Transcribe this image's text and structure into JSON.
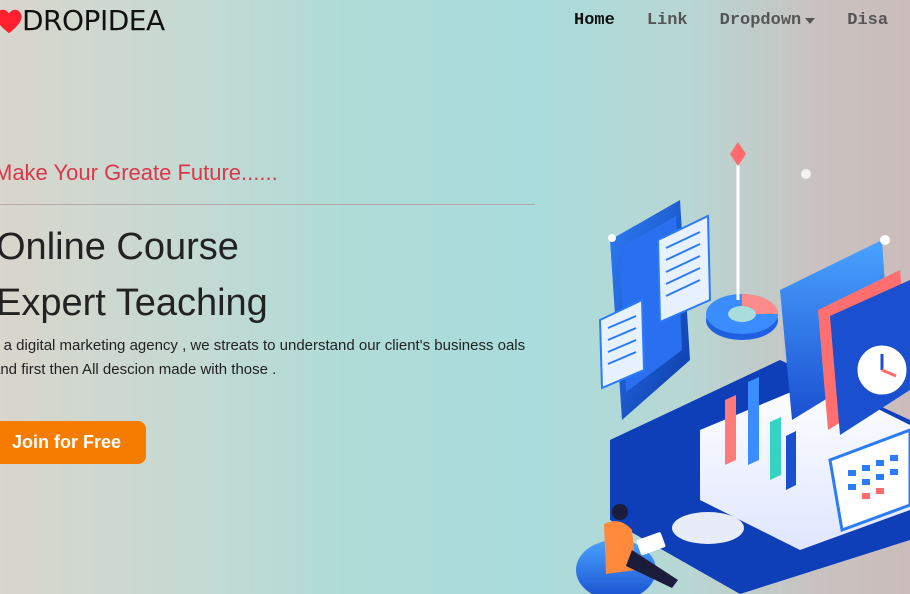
{
  "brand": {
    "name": "DROPIDEA",
    "icon": "heart-icon",
    "icon_color": "#ff1f2f"
  },
  "nav": {
    "items": [
      {
        "label": "Home",
        "active": true
      },
      {
        "label": "Link",
        "active": false
      },
      {
        "label": "Dropdown",
        "active": false,
        "has_caret": true
      },
      {
        "label": "Disa",
        "active": false
      }
    ]
  },
  "hero": {
    "tagline": "Make Your Greate Future......",
    "headline_line1": "Online Course",
    "headline_line2": "Expert Teaching",
    "description": "s a digital marketing agency , we streats to understand our client's business oals and first then All descion made with those .",
    "cta_label": "Join for Free",
    "cta_color": "#f57c00",
    "tagline_color": "#d9384a"
  },
  "illustration": {
    "icon": "online-education-illustration"
  }
}
